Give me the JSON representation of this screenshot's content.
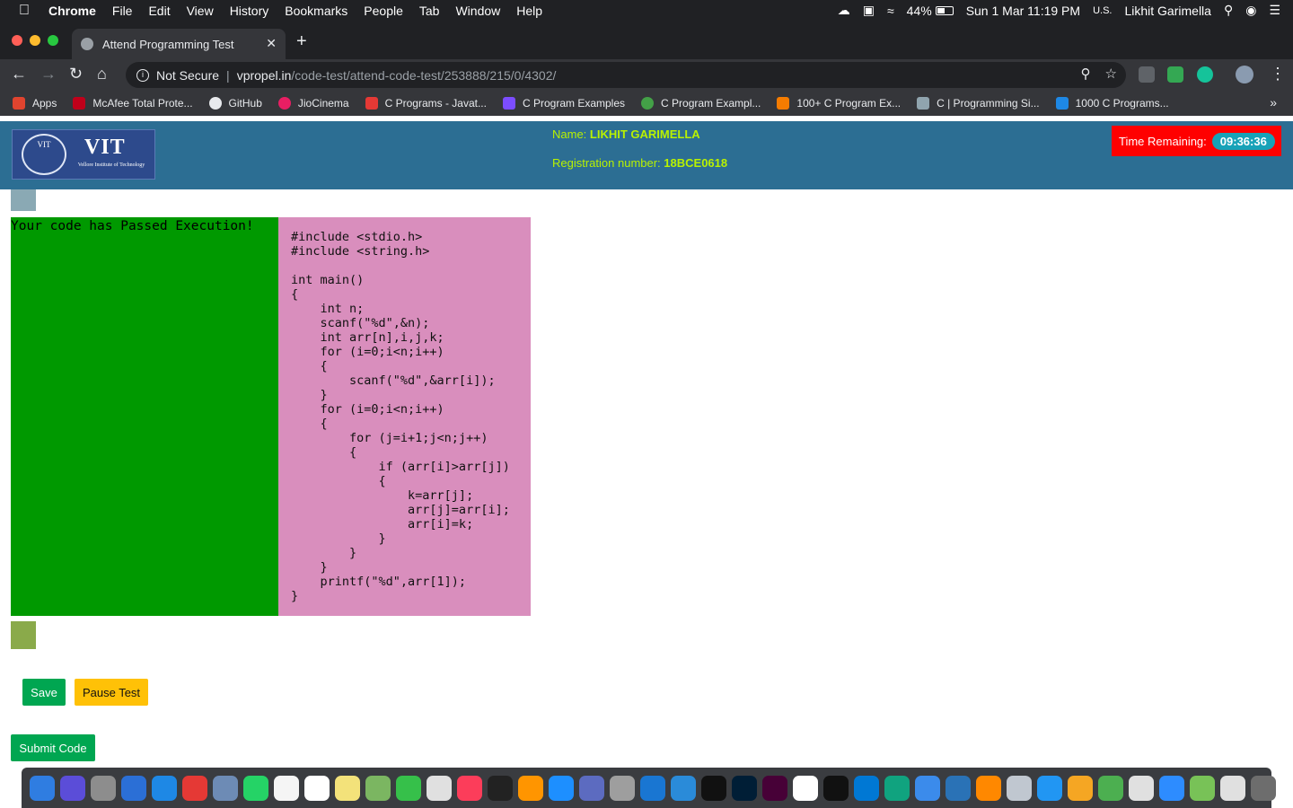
{
  "menubar": {
    "app": "Chrome",
    "menus": [
      "File",
      "Edit",
      "View",
      "History",
      "Bookmarks",
      "People",
      "Tab",
      "Window",
      "Help"
    ],
    "battery": "44%",
    "datetime": "Sun 1 Mar  11:19 PM",
    "input_source": "U.S.",
    "user": "Likhit Garimella"
  },
  "browser": {
    "tab_title": "Attend Programming Test",
    "security_label": "Not Secure",
    "url_host": "vpropel.in",
    "url_path": "/code-test/attend-code-test/253888/215/0/4302/"
  },
  "bookmarks": [
    {
      "label": "Apps",
      "color": "#e0442f"
    },
    {
      "label": "McAfee Total Prote...",
      "color": "#c0001a"
    },
    {
      "label": "GitHub",
      "color": "#e8eaed"
    },
    {
      "label": "JioCinema",
      "color": "#e91e63"
    },
    {
      "label": "C Programs - Javat...",
      "color": "#e53935"
    },
    {
      "label": "C Program Examples",
      "color": "#7c4dff"
    },
    {
      "label": "C Program Exampl...",
      "color": "#43a047"
    },
    {
      "label": "100+ C Program Ex...",
      "color": "#f57c00"
    },
    {
      "label": "C | Programming Si...",
      "color": "#90a4ae"
    },
    {
      "label": "1000 C Programs...",
      "color": "#1e88e5"
    }
  ],
  "header": {
    "logo_text": "VIT",
    "logo_emblem": "VIT",
    "logo_subtitle": "Vellore Institute of Technology",
    "name_label": "Name: ",
    "name_value": "LIKHIT GARIMELLA",
    "reg_label": "Registration number: ",
    "reg_value": "18BCE0618",
    "timer_label": "Time Remaining:",
    "timer_value": "09:36:36"
  },
  "result_text": "Your code has Passed Execution!",
  "code": "#include <stdio.h>\n#include <string.h>\n\nint main()\n{\n    int n;\n    scanf(\"%d\",&n);\n    int arr[n],i,j,k;\n    for (i=0;i<n;i++)\n    {\n        scanf(\"%d\",&arr[i]);\n    }\n    for (i=0;i<n;i++)\n    {\n        for (j=i+1;j<n;j++)\n        {\n            if (arr[i]>arr[j])\n            {\n                k=arr[j];\n                arr[j]=arr[i];\n                arr[i]=k;\n            }\n        }\n    }\n    printf(\"%d\",arr[1]);\n}",
  "buttons": {
    "save": "Save",
    "pause": "Pause Test",
    "submit": "Submit Code"
  },
  "dock_colors": [
    "#2f7de1",
    "#5b4dd8",
    "#8d8d8d",
    "#2b6fd6",
    "#1e88e5",
    "#e53935",
    "#6d8bb5",
    "#25d366",
    "#f5f5f5",
    "#ffffff",
    "#f3e27a",
    "#7bb661",
    "#36c04a",
    "#e0e0e0",
    "#fc3d5a",
    "#222222",
    "#ff9500",
    "#1d8fff",
    "#5c6bc0",
    "#9e9e9e",
    "#1976d2",
    "#2a8bd9",
    "#111111",
    "#001e36",
    "#470137",
    "#ffffff",
    "#111111",
    "#0078d4",
    "#10a37f",
    "#3b8beb",
    "#2a72b6",
    "#ff8800",
    "#c0c7d0",
    "#2196f3",
    "#f5a623",
    "#4caf50",
    "#e0e0e0",
    "#2d8cff",
    "#78c257",
    "#e0e0e0",
    "#6d6d6d"
  ]
}
